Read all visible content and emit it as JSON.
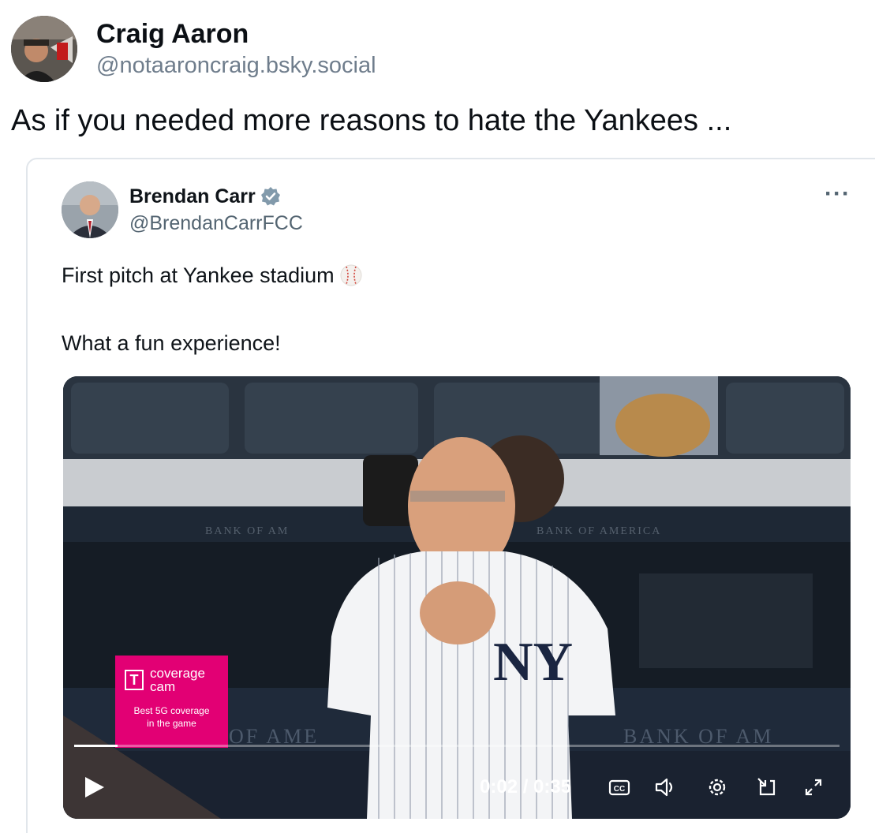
{
  "post": {
    "author_name": "Craig Aaron",
    "author_handle": "@notaaroncraig.bsky.social",
    "text": "As if you needed more reasons to hate the Yankees ..."
  },
  "quoted": {
    "author_name": "Brendan Carr",
    "author_handle": "@BrendanCarrFCC",
    "line1": "First pitch at Yankee stadium",
    "line2": "What a fun experience!",
    "more_label": "···"
  },
  "video": {
    "current_time": "0:02",
    "duration": "0:35",
    "time_label": "0:02 / 0:35",
    "progress": 0.057,
    "promo": {
      "logo": "T",
      "brand_line1": "coverage",
      "brand_line2": "cam",
      "tagline_line1": "Best 5G coverage",
      "tagline_line2": "in the game"
    },
    "banner_text": "BANK OF AMERICA",
    "lower_banner_left": "OF AME",
    "lower_banner_right": "BANK OF AM",
    "icons": [
      "play-icon",
      "captions-icon",
      "volume-icon",
      "settings-icon",
      "pip-icon",
      "fullscreen-icon"
    ]
  },
  "colors": {
    "handle_gray": "#6f7d8c",
    "verified_blue": "#829aab",
    "tmobile_magenta": "#e20074"
  }
}
